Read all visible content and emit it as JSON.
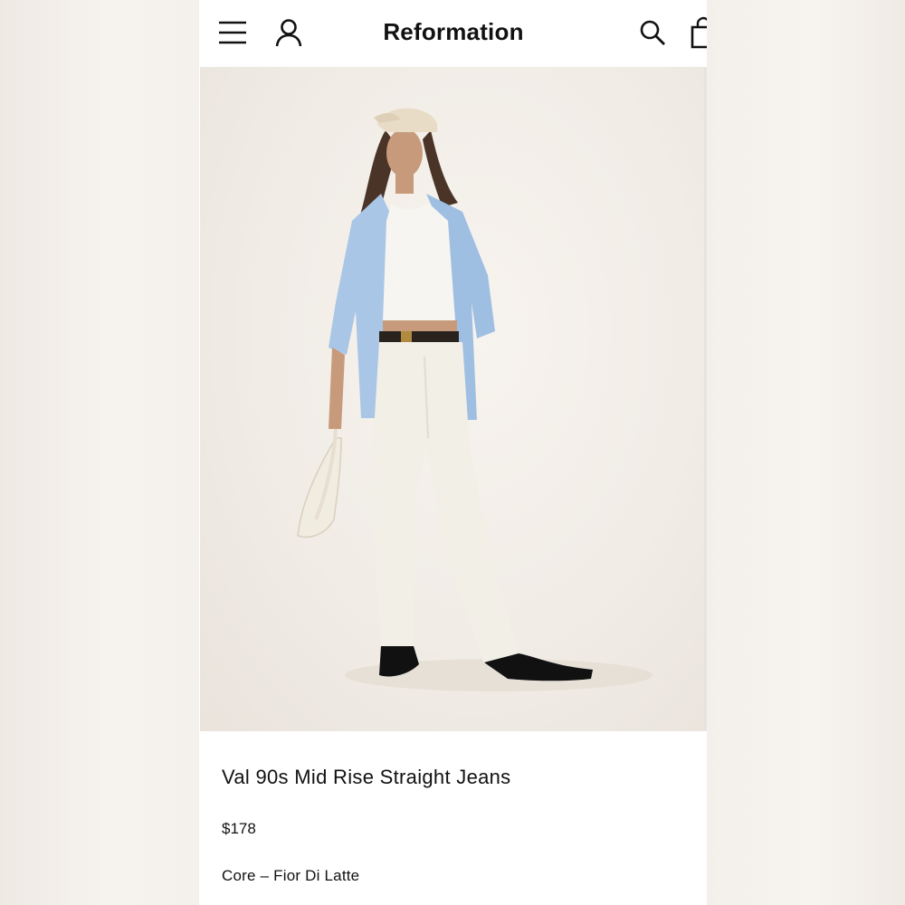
{
  "header": {
    "brand": "Reformation",
    "icons": [
      "menu-icon",
      "account-icon",
      "search-icon",
      "bag-icon"
    ]
  },
  "hero": {
    "image": "model-photo"
  },
  "product": {
    "title": "Val 90s Mid Rise Straight Jeans",
    "price": "$178",
    "color": "Core – Fior Di Latte"
  },
  "colors": {
    "text": "#111111",
    "background": "#ffffff",
    "hero_bg": "#f1ece6",
    "shirt": "#a9c6e6",
    "jeans": "#f2efe7",
    "cap": "#e8dcc6"
  }
}
